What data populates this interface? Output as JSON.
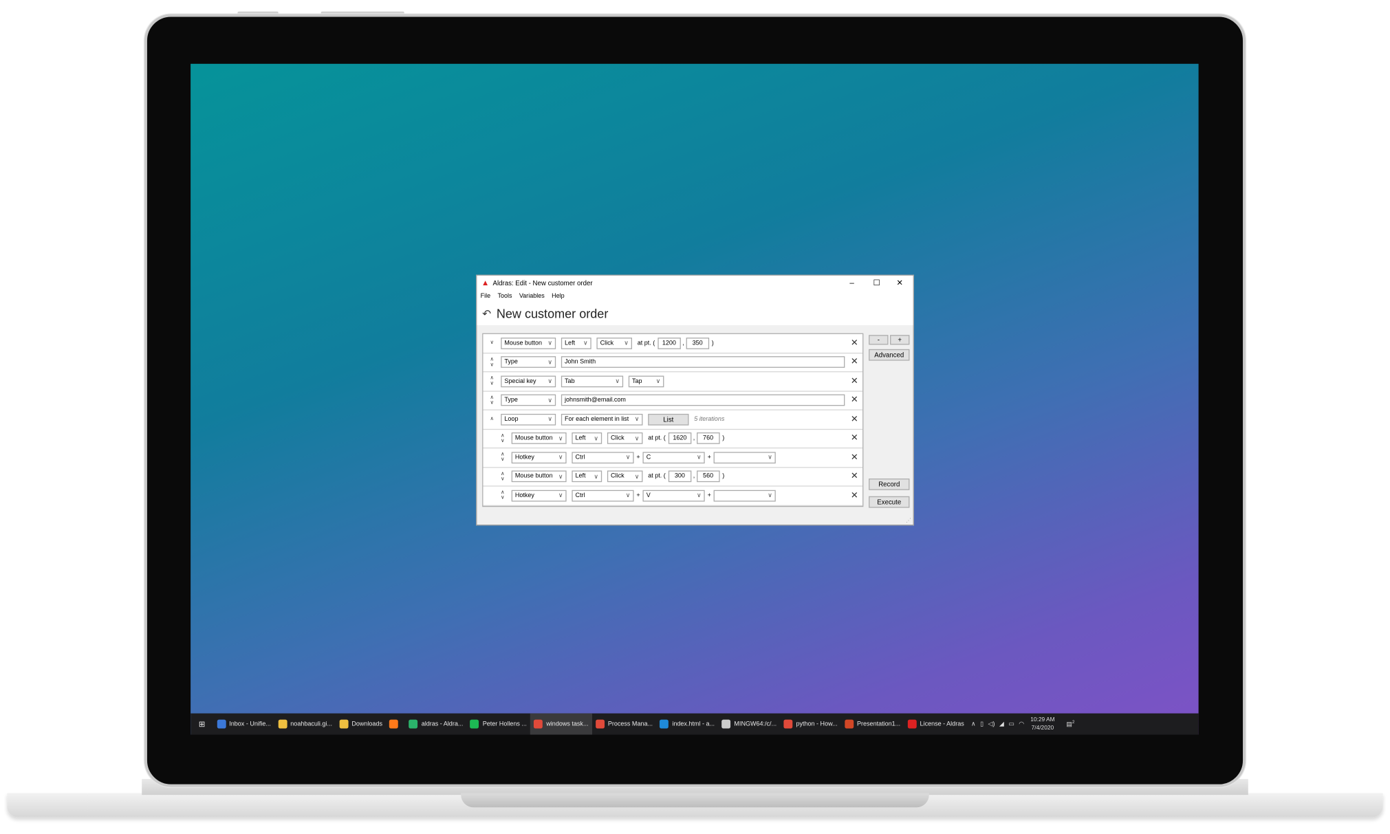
{
  "window": {
    "title": "Aldras: Edit - New customer order",
    "controls": [
      "–",
      "☐",
      "✕"
    ],
    "menu": [
      "File",
      "Tools",
      "Variables",
      "Help"
    ],
    "page_title": "New customer order"
  },
  "rows": [
    {
      "type": "Mouse button",
      "b": "Left",
      "c": "Click",
      "pt_label": "at pt. (",
      "x": "1200",
      "sep": ",",
      "y": "350",
      "close": ")"
    },
    {
      "type": "Type",
      "text": "John Smith"
    },
    {
      "type": "Special key",
      "b": "Tab",
      "c": "Tap"
    },
    {
      "type": "Type",
      "text": "johnsmith@email.com"
    },
    {
      "type": "Loop",
      "b": "For each element in list",
      "btn": "List",
      "note": "5 iterations"
    },
    {
      "type": "Mouse button",
      "b": "Left",
      "c": "Click",
      "pt_label": "at pt. (",
      "x": "1620",
      "sep": ",",
      "y": "760",
      "close": ")"
    },
    {
      "type": "Hotkey",
      "b": "Ctrl",
      "plus": "+",
      "c": "C",
      "plus2": "+",
      "d": ""
    },
    {
      "type": "Mouse button",
      "b": "Left",
      "c": "Click",
      "pt_label": "at pt. (",
      "x": "300",
      "sep": ",",
      "y": "560",
      "close": ")"
    },
    {
      "type": "Hotkey",
      "b": "Ctrl",
      "plus": "+",
      "c": "V",
      "plus2": "+",
      "d": ""
    }
  ],
  "side": {
    "minus": "-",
    "plus": "+",
    "advanced": "Advanced",
    "record": "Record",
    "execute": "Execute"
  },
  "taskbar": {
    "items": [
      {
        "label": "Inbox - Unifie...",
        "color": "#3b78d8"
      },
      {
        "label": "noahbaculi.gi...",
        "color": "#f0c040"
      },
      {
        "label": "Downloads",
        "color": "#f0c040"
      },
      {
        "label": "",
        "color": "#ff7a1a"
      },
      {
        "label": "aldras - Aldra...",
        "color": "#2bb36a"
      },
      {
        "label": "Peter Hollens ...",
        "color": "#1db954"
      },
      {
        "label": "windows task...",
        "color": "#e04a3a"
      },
      {
        "label": "Process Mana...",
        "color": "#e04a3a"
      },
      {
        "label": "index.html - a...",
        "color": "#1f8ad8"
      },
      {
        "label": "MINGW64:/c/...",
        "color": "#cccccc"
      },
      {
        "label": "python - How...",
        "color": "#e04a3a"
      },
      {
        "label": "Presentation1...",
        "color": "#d24726"
      },
      {
        "label": "License - Aldras",
        "color": "#d22"
      }
    ],
    "time": "10:29 AM",
    "date": "7/4/2020",
    "notifications": "2"
  }
}
